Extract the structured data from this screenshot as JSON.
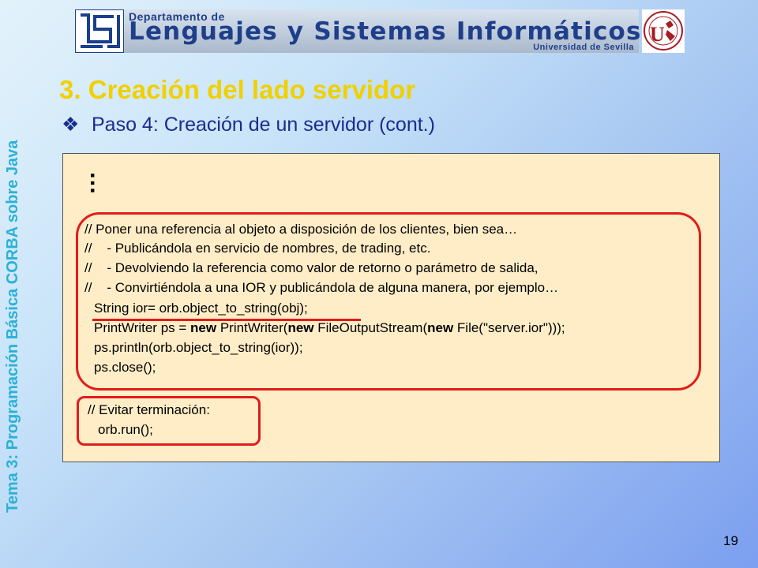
{
  "header": {
    "department_label": "Departamento de",
    "title": "Lenguajes y Sistemas Informáticos",
    "university": "Universidad de Sevilla"
  },
  "side_label": "Tema 3: Programación Básica CORBA sobre Java",
  "slide": {
    "title": "3. Creación del lado servidor",
    "bullet_icon": "❖",
    "subtitle": "Paso 4: Creación de un servidor (cont.)",
    "ellipsis": "…",
    "page_number": "19"
  },
  "code": {
    "comment_lines": [
      "// Poner una referencia al objeto a disposición de los clientes, bien sea…",
      "//    - Publicándola en servicio de nombres, de trading, etc.",
      "//    - Devolviendo la referencia como valor de retorno o parámetro de salida,",
      "//    - Convirtiéndola a una IOR y publicándola de alguna manera, por ejemplo…"
    ],
    "line_ior": "String ior= orb.object_to_string(obj);",
    "line_pw_parts": [
      "PrintWriter ps = ",
      "new",
      " PrintWriter(",
      "new",
      " FileOutputStream(",
      "new",
      " File(\"server.ior\")));"
    ],
    "line_println": "ps.println(orb.object_to_string(ior));",
    "line_close": "ps.close();",
    "line_comment_run": "// Evitar terminación:",
    "line_run": "orb.run();"
  },
  "colors": {
    "title": "#f0d000",
    "subtitle": "#1a2c8e",
    "side_label": "#2bb1d6",
    "highlight": "#e21b1b",
    "code_bg": "#ffedc7"
  }
}
